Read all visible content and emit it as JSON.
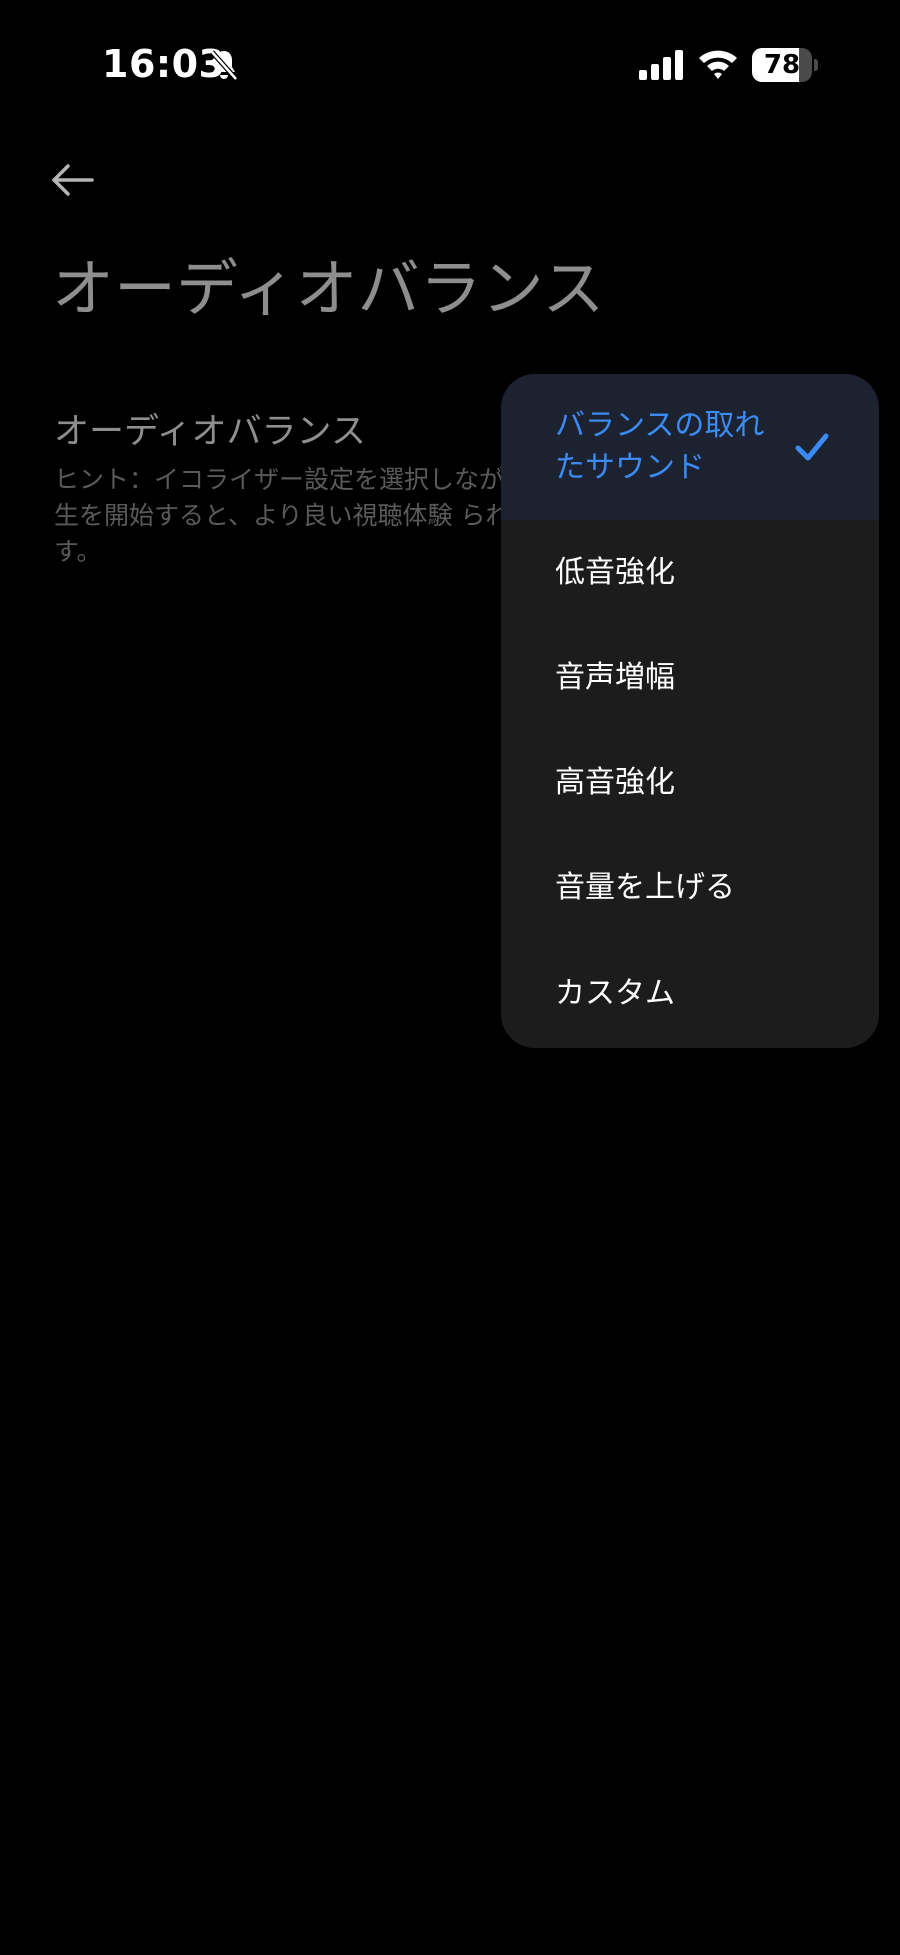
{
  "status_bar": {
    "time": "16:03",
    "battery_level": "78",
    "battery_fraction": 0.78,
    "icons": [
      "bell-slash-icon",
      "cellular-signal-icon",
      "wifi-icon",
      "battery-icon"
    ]
  },
  "header": {
    "back_icon": "arrow-left-icon",
    "title": "オーディオバランス"
  },
  "setting": {
    "title": "オーディオバランス",
    "hint": "ヒント：イコライザー設定を選択しなが の再生を開始すると、より良い視聴体験 られます。"
  },
  "dropdown": {
    "items": [
      {
        "label": "バランスの取れたサウンド",
        "selected": true
      },
      {
        "label": "低音強化",
        "selected": false
      },
      {
        "label": "音声増幅",
        "selected": false
      },
      {
        "label": "高音強化",
        "selected": false
      },
      {
        "label": "音量を上げる",
        "selected": false
      },
      {
        "label": "カスタム",
        "selected": false
      }
    ],
    "check_icon": "checkmark-icon"
  },
  "colors": {
    "background": "#000000",
    "menu_background": "#1c1c1c",
    "selected_background": "#1c2230",
    "accent": "#3b8bf5",
    "muted_text": "#8e8e8e",
    "hint_text": "#5a5a5a"
  }
}
